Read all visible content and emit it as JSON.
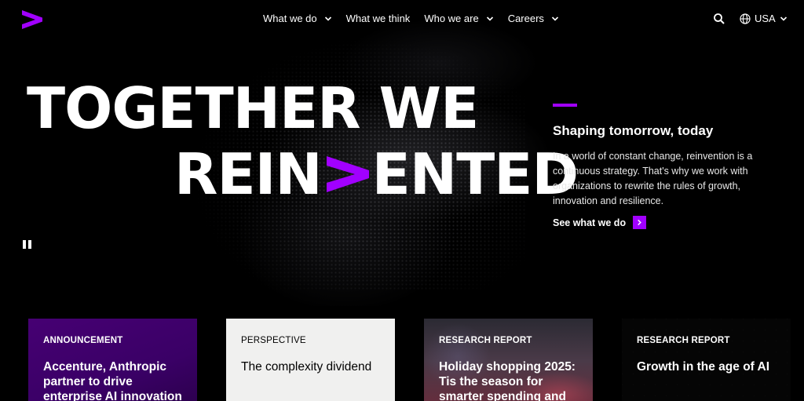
{
  "brand": {
    "accent_color": "#a100ff",
    "logo_icon": "accenture-gt-logo"
  },
  "nav": {
    "items": [
      {
        "label": "What we do",
        "has_dropdown": true
      },
      {
        "label": "What we think",
        "has_dropdown": false
      },
      {
        "label": "Who we are",
        "has_dropdown": true
      },
      {
        "label": "Careers",
        "has_dropdown": true
      }
    ],
    "search_icon": "search-icon",
    "locale": {
      "label": "USA",
      "icon": "globe-icon"
    }
  },
  "hero": {
    "headline_line1": "TOGETHER WE",
    "headline_line2_pre": "REIN",
    "headline_line2_post": "ENTED",
    "subtitle": "Shaping tomorrow, today",
    "body": "In a world of constant change, reinvention is a continuous strategy. That's why we work with organizations to rewrite the rules of growth, innovation and resilience.",
    "cta_label": "See what we do"
  },
  "cards": [
    {
      "label": "ANNOUNCEMENT",
      "title": "Accenture, Anthropic partner to drive enterprise AI innovation"
    },
    {
      "label": "PERSPECTIVE",
      "title": "The complexity dividend"
    },
    {
      "label": "RESEARCH REPORT",
      "title": "Holiday shopping 2025: Tis the season for smarter spending and"
    },
    {
      "label": "RESEARCH REPORT",
      "title": "Growth in the age of AI"
    }
  ]
}
